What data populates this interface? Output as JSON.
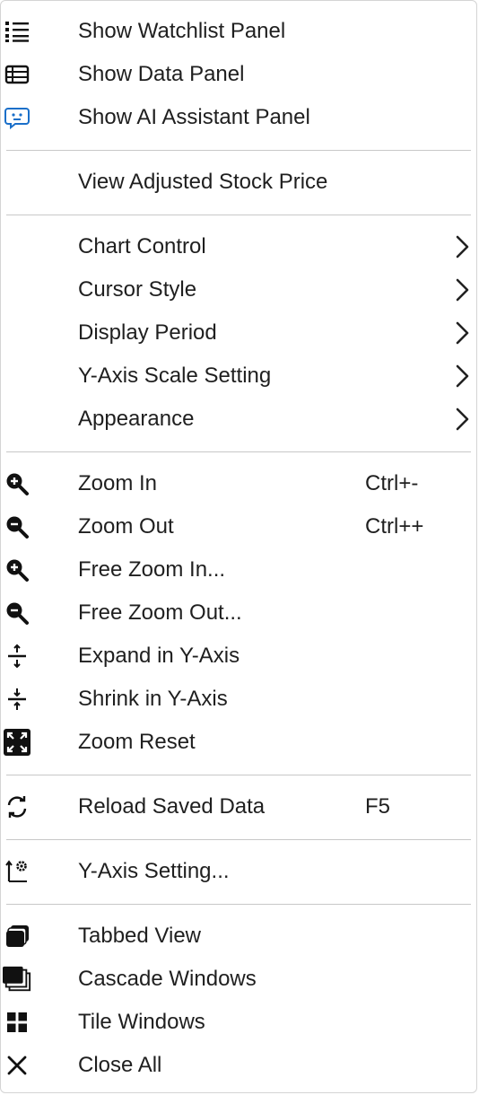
{
  "menu": {
    "panels": [
      {
        "label": "Show Watchlist Panel",
        "icon": "list-bullets-icon"
      },
      {
        "label": "Show Data Panel",
        "icon": "table-icon"
      },
      {
        "label": "Show AI Assistant Panel",
        "icon": "ai-assistant-icon"
      }
    ],
    "adjusted": {
      "label": "View Adjusted Stock Price"
    },
    "submenus": [
      {
        "label": "Chart Control"
      },
      {
        "label": "Cursor Style"
      },
      {
        "label": "Display Period"
      },
      {
        "label": "Y-Axis Scale Setting"
      },
      {
        "label": "Appearance"
      }
    ],
    "zoom": [
      {
        "label": "Zoom In",
        "shortcut": "Ctrl+-",
        "icon": "zoom-in-icon"
      },
      {
        "label": "Zoom Out",
        "shortcut": "Ctrl++",
        "icon": "zoom-out-icon"
      },
      {
        "label": "Free Zoom In...",
        "icon": "free-zoom-in-icon"
      },
      {
        "label": "Free Zoom Out...",
        "icon": "free-zoom-out-icon"
      },
      {
        "label": "Expand in Y-Axis",
        "icon": "expand-y-icon"
      },
      {
        "label": "Shrink in Y-Axis",
        "icon": "shrink-y-icon"
      },
      {
        "label": "Zoom Reset",
        "icon": "zoom-reset-icon"
      }
    ],
    "reload": {
      "label": "Reload Saved Data",
      "shortcut": "F5",
      "icon": "reload-icon"
    },
    "yaxis": {
      "label": "Y-Axis Setting...",
      "icon": "y-axis-setting-icon"
    },
    "windows": [
      {
        "label": "Tabbed View",
        "icon": "tabbed-view-icon"
      },
      {
        "label": "Cascade Windows",
        "icon": "cascade-windows-icon"
      },
      {
        "label": "Tile Windows",
        "icon": "tile-windows-icon"
      },
      {
        "label": "Close All",
        "icon": "close-icon"
      }
    ]
  }
}
